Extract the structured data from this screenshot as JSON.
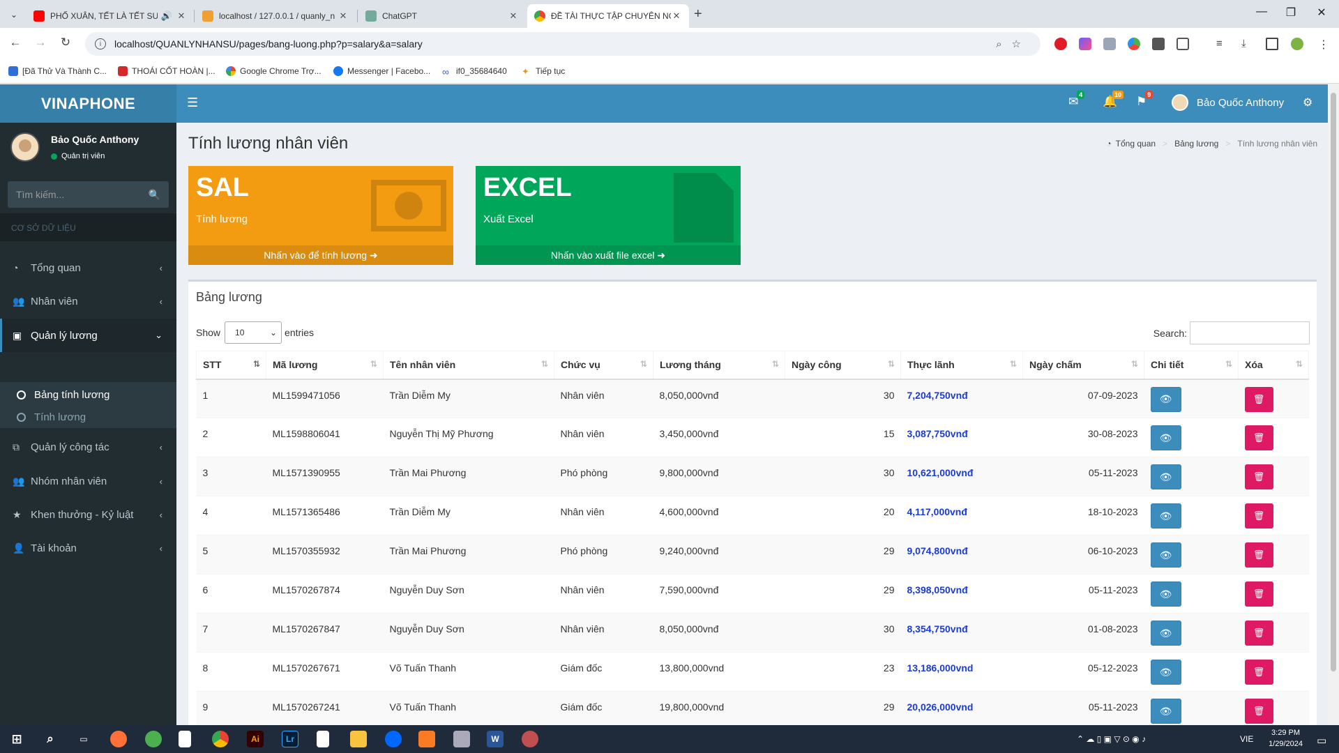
{
  "browser": {
    "tabs": [
      {
        "title": "PHỐ XUÂN, TẾT LÀ TẾT SUM",
        "active": false
      },
      {
        "title": "localhost / 127.0.0.1 / quanly_n",
        "active": false
      },
      {
        "title": "ChatGPT",
        "active": false
      },
      {
        "title": "ĐỀ TÀI THỰC TẬP CHUYÊN NG",
        "active": true
      }
    ],
    "url": "localhost/QUANLYNHANSU/pages/bang-luong.php?p=salary&a=salary",
    "bookmarks": [
      "[Đã Thử Và Thành C...",
      "THOÁI CỐT HOÀN |...",
      "Google Chrome Trợ...",
      "Messenger | Facebo...",
      "if0_35684640",
      "Tiếp tục"
    ]
  },
  "header": {
    "brand": "VINAPHONE",
    "badges": {
      "mail": "4",
      "bell": "10",
      "flag": "9"
    },
    "user_name": "Bảo Quốc Anthony"
  },
  "sidebar": {
    "user_name": "Bảo Quốc Anthony",
    "user_role": "Quản trị viên",
    "search_placeholder": "Tìm kiếm...",
    "section_header": "CƠ SỞ DỮ LIỆU",
    "menu": [
      {
        "label": "Tổng quan",
        "icon": "dashboard-icon"
      },
      {
        "label": "Nhân viên",
        "icon": "users-icon"
      },
      {
        "label": "Quản lý lương",
        "icon": "money-icon"
      },
      {
        "label": "Quản lý công tác",
        "icon": "copy-icon"
      },
      {
        "label": "Nhóm nhân viên",
        "icon": "users-icon"
      },
      {
        "label": "Khen thưởng - Kỷ luật",
        "icon": "star-icon"
      },
      {
        "label": "Tài khoản",
        "icon": "user-icon"
      }
    ],
    "submenu": [
      {
        "label": "Bảng tính lương"
      },
      {
        "label": "Tính lương"
      }
    ]
  },
  "content": {
    "page_title": "Tính lương nhân viên",
    "breadcrumb": [
      "Tổng quan",
      "Bảng lương",
      "Tính lương nhân viên"
    ],
    "boxes": [
      {
        "big": "SAL",
        "sub": "Tính lương",
        "footer": "Nhấn vào để tính lương",
        "color": "#f39c12"
      },
      {
        "big": "EXCEL",
        "sub": "Xuất Excel",
        "footer": "Nhấn vào xuất file excel",
        "color": "#00a65a"
      }
    ],
    "table_title": "Bảng lương",
    "show_label": "Show",
    "entries_value": "10",
    "entries_label": "entries",
    "search_label": "Search:",
    "columns": [
      "STT",
      "Mã lương",
      "Tên nhân viên",
      "Chức vụ",
      "Lương tháng",
      "Ngày công",
      "Thực lãnh",
      "Ngày chấm",
      "Chi tiết",
      "Xóa"
    ],
    "rows": [
      [
        "1",
        "ML1599471056",
        "Trần Diễm My",
        "Nhân viên",
        "8,050,000vnđ",
        "30",
        "7,204,750vnđ",
        "07-09-2023"
      ],
      [
        "2",
        "ML1598806041",
        "Nguyễn Thị Mỹ Phương",
        "Nhân viên",
        "3,450,000vnđ",
        "15",
        "3,087,750vnđ",
        "30-08-2023"
      ],
      [
        "3",
        "ML1571390955",
        "Trần Mai Phương",
        "Phó phòng",
        "9,800,000vnđ",
        "30",
        "10,621,000vnđ",
        "05-11-2023"
      ],
      [
        "4",
        "ML1571365486",
        "Trần Diễm My",
        "Nhân viên",
        "4,600,000vnđ",
        "20",
        "4,117,000vnđ",
        "18-10-2023"
      ],
      [
        "5",
        "ML1570355932",
        "Trần Mai Phương",
        "Phó phòng",
        "9,240,000vnđ",
        "29",
        "9,074,800vnđ",
        "06-10-2023"
      ],
      [
        "6",
        "ML1570267874",
        "Nguyễn Duy Sơn",
        "Nhân viên",
        "7,590,000vnđ",
        "29",
        "8,398,050vnđ",
        "05-11-2023"
      ],
      [
        "7",
        "ML1570267847",
        "Nguyễn Duy Sơn",
        "Nhân viên",
        "8,050,000vnđ",
        "30",
        "8,354,750vnđ",
        "01-08-2023"
      ],
      [
        "8",
        "ML1570267671",
        "Võ Tuấn Thanh",
        "Giám đốc",
        "13,800,000vnd",
        "23",
        "13,186,000vnd",
        "05-12-2023"
      ],
      [
        "9",
        "ML1570267241",
        "Võ Tuấn Thanh",
        "Giám đốc",
        "19,800,000vnd",
        "29",
        "20,026,000vnd",
        "05-11-2023"
      ]
    ]
  },
  "taskbar": {
    "lang": "VIE",
    "time": "3:29 PM",
    "date": "1/29/2024"
  }
}
